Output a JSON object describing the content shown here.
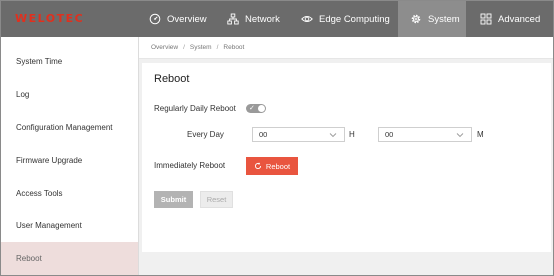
{
  "brand": {
    "logo_text": "WELOTEC",
    "logo_color": "#e0301e"
  },
  "topnav": {
    "items": [
      {
        "label": "Overview",
        "icon": "gauge-icon"
      },
      {
        "label": "Network",
        "icon": "network-icon"
      },
      {
        "label": "Edge Computing",
        "icon": "eye-icon"
      },
      {
        "label": "System",
        "icon": "gear-icon",
        "active": true
      },
      {
        "label": "Advanced",
        "icon": "grid-icon"
      }
    ]
  },
  "sidebar": {
    "items": [
      {
        "label": "System Time"
      },
      {
        "label": "Log"
      },
      {
        "label": "Configuration Management"
      },
      {
        "label": "Firmware Upgrade"
      },
      {
        "label": "Access Tools"
      },
      {
        "label": "User Management"
      },
      {
        "label": "Reboot",
        "active": true
      }
    ]
  },
  "breadcrumb": {
    "items": [
      "Overview",
      "System",
      "Reboot"
    ],
    "separator": "/"
  },
  "card": {
    "title": "Reboot",
    "regular_label": "Regularly Daily Reboot",
    "toggle_on": true,
    "toggle_mark": "✓",
    "every_day_label": "Every Day",
    "hour_value": "00",
    "hour_unit": "H",
    "minute_value": "00",
    "minute_unit": "M",
    "immediate_label": "Immediately Reboot",
    "reboot_label": "Reboot",
    "submit_label": "Submit",
    "reset_label": "Reset"
  },
  "colors": {
    "accent": "#e9553f",
    "nav_bg": "#6b6b6b",
    "nav_active": "#8d8d8d",
    "sidebar_active": "#eedddc"
  }
}
